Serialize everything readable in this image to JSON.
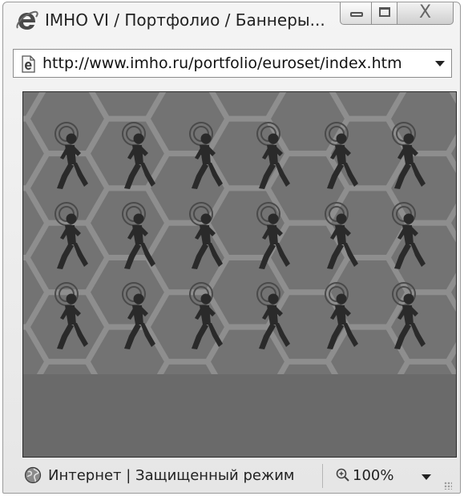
{
  "window": {
    "title": "IMHO VI / Портфолио / Баннеры...",
    "close_glyph": "X"
  },
  "address_bar": {
    "url": "http://www.imho.ru/portfolio/euroset/index.htm",
    "icon": "ie-page-icon"
  },
  "content": {
    "description_icon": "walking-man-icon",
    "colors": {
      "background": "#6a6a6a",
      "hex_fill": "#737373",
      "hex_edge": "#8e8e8e",
      "figure": "#2a2a2a"
    }
  },
  "status_bar": {
    "zone": "Интернет | Защищенный режим",
    "zoom": "100%",
    "icons": [
      "globe-icon",
      "zoom-icon"
    ]
  }
}
